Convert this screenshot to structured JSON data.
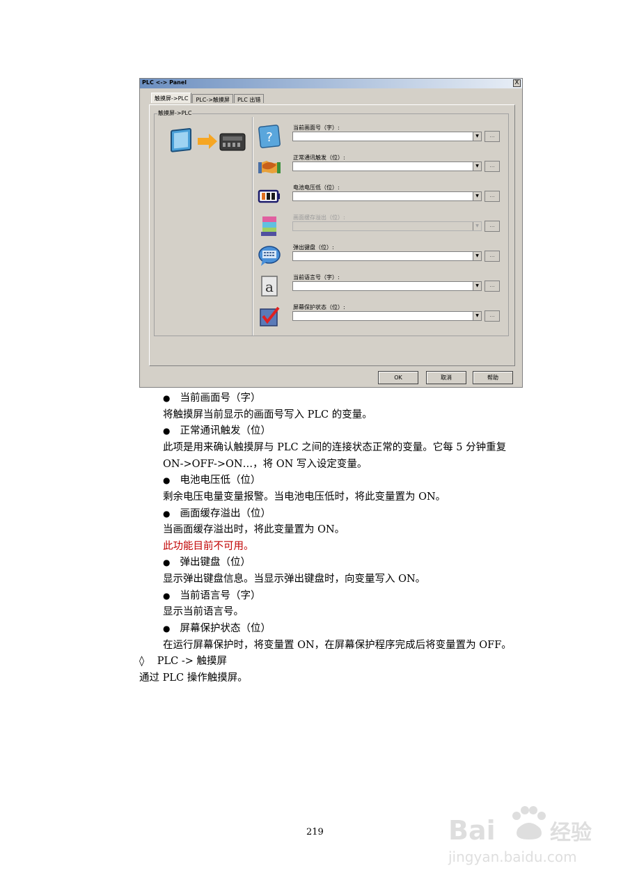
{
  "dialog": {
    "title": "PLC <-> Panel",
    "close_label": "X",
    "tabs": [
      "触摸屏->PLC",
      "PLC->触摸屏",
      "PLC 出错"
    ],
    "group_title": "触摸屏->PLC",
    "rows": [
      {
        "label": "当前画面号（字）:",
        "icon": "help-question-icon",
        "enabled": true
      },
      {
        "label": "正常通讯触发（位）:",
        "icon": "handshake-icon",
        "enabled": true
      },
      {
        "label": "电池电压低（位）:",
        "icon": "battery-icon",
        "enabled": true
      },
      {
        "label": "画面缓存溢出（位）:",
        "icon": "buffer-stack-icon",
        "enabled": false
      },
      {
        "label": "弹出键盘（位）:",
        "icon": "keyboard-icon",
        "enabled": true
      },
      {
        "label": "当前语言号（字）:",
        "icon": "language-a-icon",
        "enabled": true
      },
      {
        "label": "屏幕保护状态（位）:",
        "icon": "checkbox-icon",
        "enabled": true
      }
    ],
    "dropdown_arrow": "▼",
    "browse_label": "...",
    "buttons": {
      "ok": "OK",
      "cancel": "取消",
      "help": "帮助"
    },
    "colors": {
      "window_bg": "#d4d0c8",
      "title_bar": "#6c8fc0"
    }
  },
  "doc": {
    "items": [
      {
        "heading": "当前画面号（字）",
        "body": [
          "将触摸屏当前显示的画面号写入 PLC 的变量。"
        ]
      },
      {
        "heading": "正常通讯触发（位）",
        "body": [
          "此项是用来确认触摸屏与 PLC 之间的连接状态正常的变量。它每 5 分钟重复",
          "ON->OFF->ON…，将 ON 写入设定变量。"
        ]
      },
      {
        "heading": "电池电压低（位）",
        "body": [
          "剩余电压电量变量报警。当电池电压低时，将此变量置为 ON。"
        ]
      },
      {
        "heading": "画面缓存溢出（位）",
        "body": [
          "当画面缓存溢出时，将此变量置为 ON。"
        ],
        "note": "此功能目前不可用。"
      },
      {
        "heading": "弹出键盘（位）",
        "body": [
          "显示弹出键盘信息。当显示弹出键盘时，向变量写入 ON。"
        ]
      },
      {
        "heading": "当前语言号（字）",
        "body": [
          "显示当前语言号。"
        ]
      },
      {
        "heading": "屏幕保护状态（位）",
        "body": [
          "在运行屏幕保护时，将变量置 ON，在屏幕保护程序完成后将变量置为 OFF。"
        ]
      }
    ],
    "section_marker": "◊",
    "section_title": "PLC ->  触摸屏",
    "section_body": "通过 PLC 操作触摸屏。",
    "note_color": "#c00000"
  },
  "page_number": "219",
  "watermark": {
    "brand": "Baidu经验",
    "url": "jingyan.baidu.com"
  }
}
